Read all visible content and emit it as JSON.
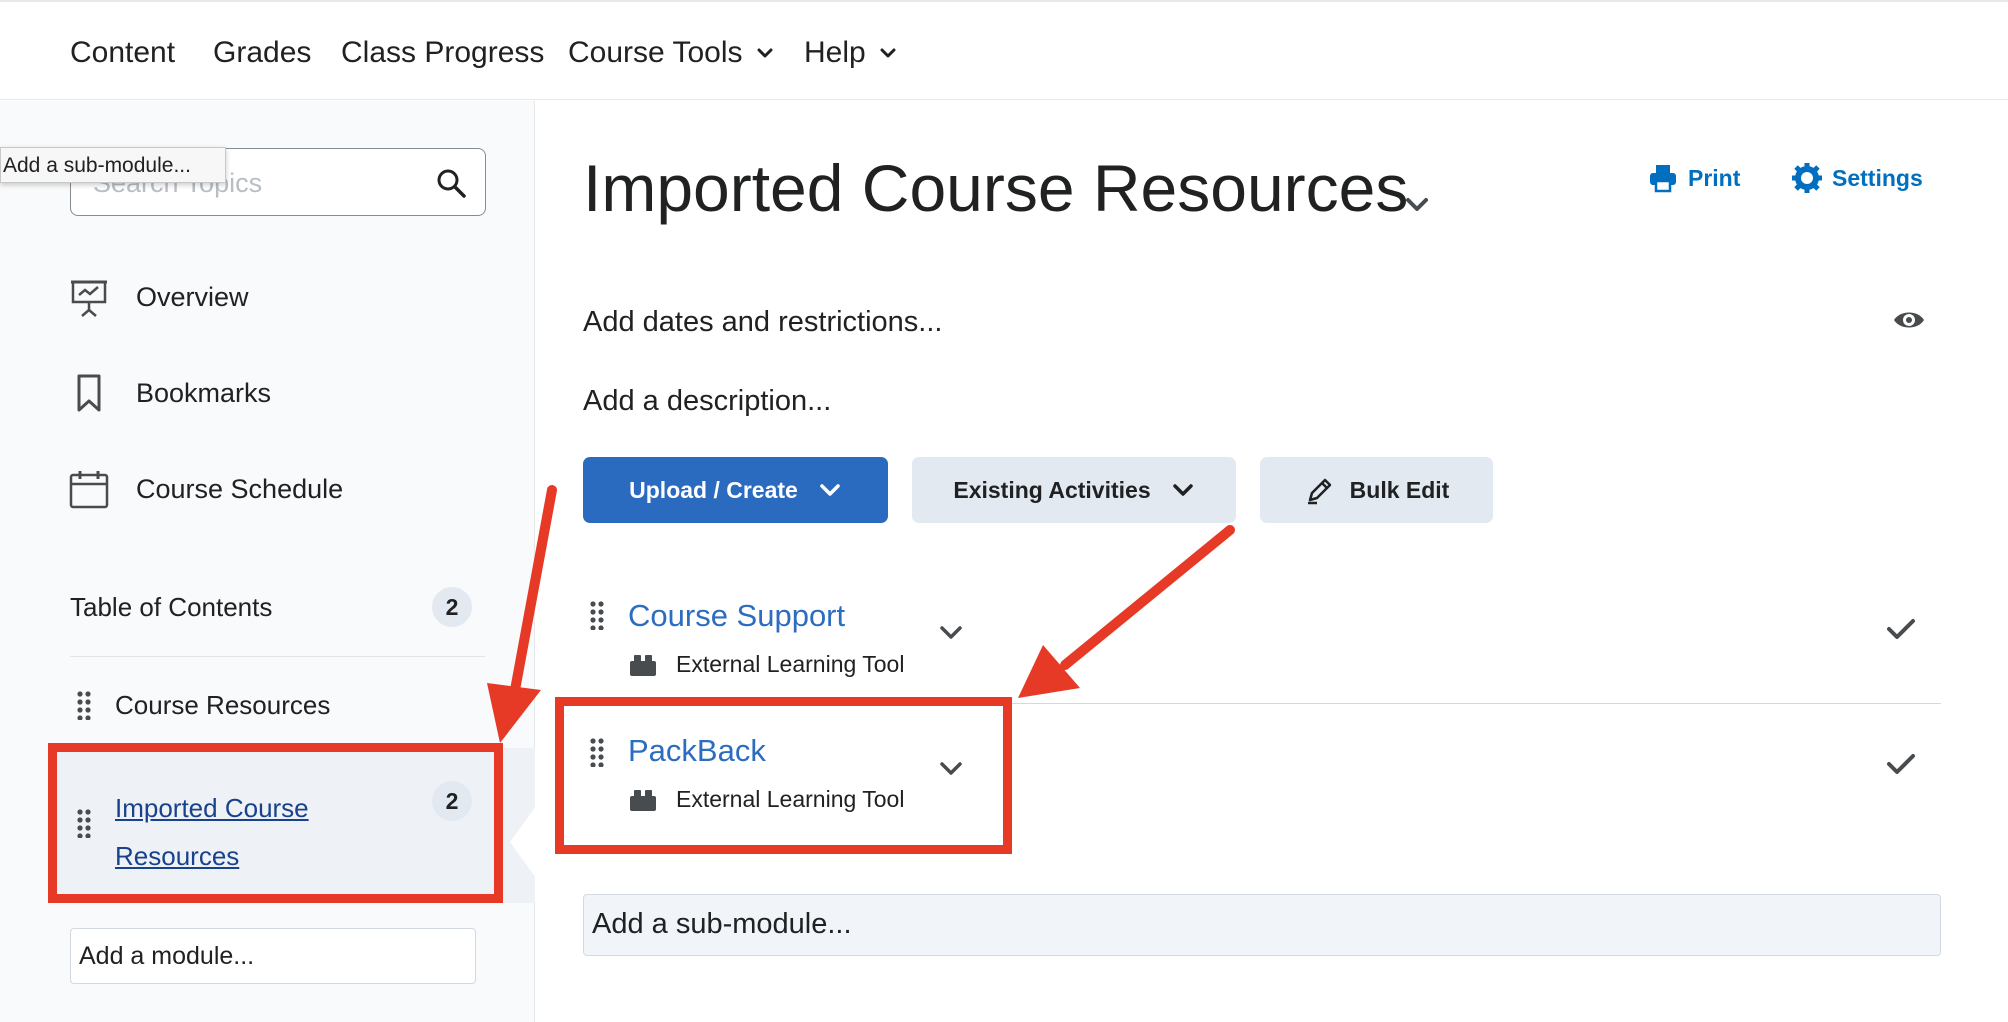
{
  "navbar": {
    "items": [
      {
        "label": "Content"
      },
      {
        "label": "Grades"
      },
      {
        "label": "Class Progress"
      },
      {
        "label": "Course Tools",
        "dropdown": true
      },
      {
        "label": "Help",
        "dropdown": true
      }
    ]
  },
  "sidebar": {
    "search": {
      "placeholder": "Search Topics",
      "value": ""
    },
    "tooltip": "Add a sub-module...",
    "links": [
      {
        "label": "Overview",
        "icon": "presentation-icon"
      },
      {
        "label": "Bookmarks",
        "icon": "bookmark-icon"
      },
      {
        "label": "Course Schedule",
        "icon": "calendar-icon"
      }
    ],
    "toc": {
      "title": "Table of Contents",
      "count": "2",
      "modules": [
        {
          "label": "Course Resources"
        },
        {
          "label": "Imported Course Resources",
          "count": "2",
          "selected": true
        }
      ]
    },
    "add_module_placeholder": "Add a module..."
  },
  "main": {
    "title": "Imported Course Resources",
    "print_label": "Print",
    "settings_label": "Settings",
    "add_dates": "Add dates and restrictions...",
    "add_description": "Add a description...",
    "buttons": {
      "upload_create": "Upload / Create",
      "existing_activities": "Existing Activities",
      "bulk_edit": "Bulk Edit"
    },
    "activities": [
      {
        "title": "Course Support",
        "type": "External Learning Tool",
        "completed": true
      },
      {
        "title": "PackBack",
        "type": "External Learning Tool",
        "completed": true
      }
    ],
    "add_submodule_placeholder": "Add a sub-module..."
  },
  "colors": {
    "accent_blue": "#2b6bbf",
    "link_blue": "#006fbf",
    "annotation_red": "#e63a26",
    "selected_link": "#19428d"
  }
}
